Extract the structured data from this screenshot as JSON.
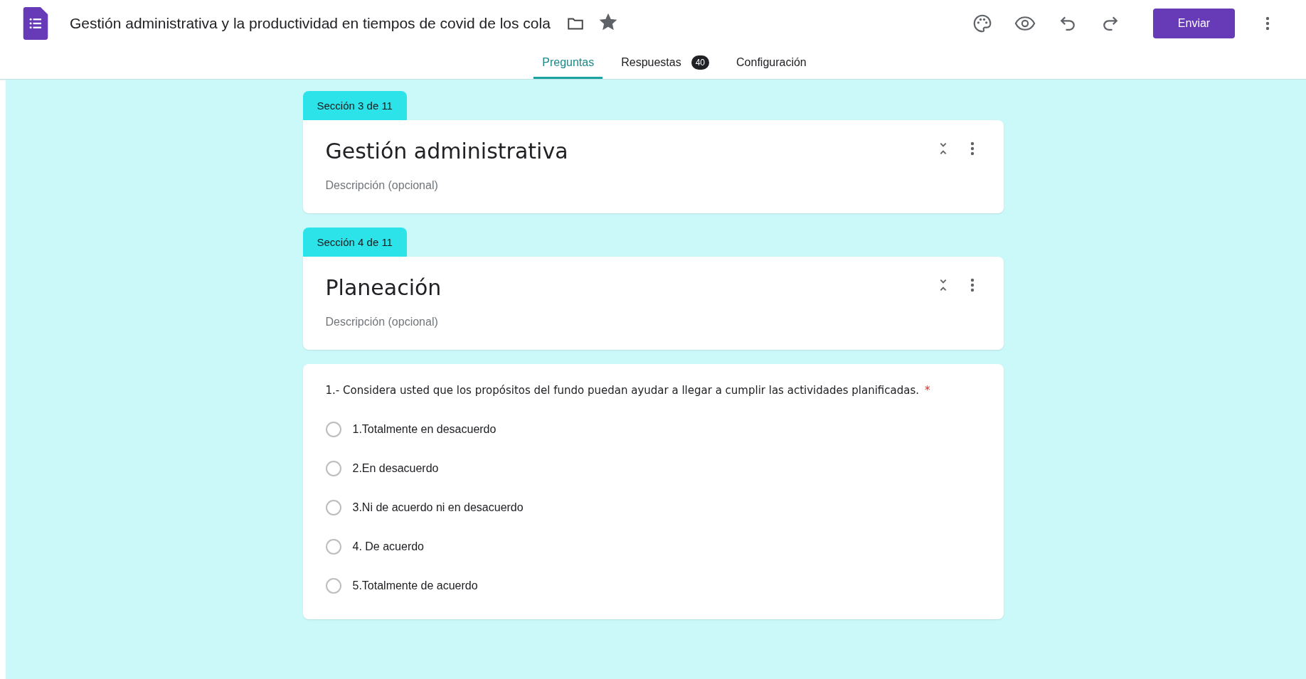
{
  "header": {
    "title": "Gestión administrativa y la productividad en tiempos de covid de los cola",
    "starred": true,
    "send_button": "Enviar"
  },
  "tabs": [
    {
      "label": "Preguntas",
      "selected": true
    },
    {
      "label": "Respuestas",
      "selected": false,
      "badge": "40"
    },
    {
      "label": "Configuración",
      "selected": false
    }
  ],
  "sections": [
    {
      "tag": "Sección 3 de 11",
      "title": "Gestión administrativa",
      "description_placeholder": "Descripción (opcional)"
    },
    {
      "tag": "Sección 4 de 11",
      "title": "Planeación",
      "description_placeholder": "Descripción (opcional)"
    }
  ],
  "question": {
    "text": "1.- Considera usted que los propósitos del fundo puedan ayudar a llegar a cumplir las actividades planificadas.",
    "required": true,
    "mark": "*",
    "options": [
      {
        "label": "1.Totalmente en desacuerdo",
        "selected": false
      },
      {
        "label": "2.En desacuerdo",
        "selected": false
      },
      {
        "label": "3.Ni de acuerdo ni en desacuerdo",
        "selected": false
      },
      {
        "label": "4. De acuerdo",
        "selected": false
      },
      {
        "label": "5.Totalmente de acuerdo",
        "selected": false
      }
    ]
  }
}
